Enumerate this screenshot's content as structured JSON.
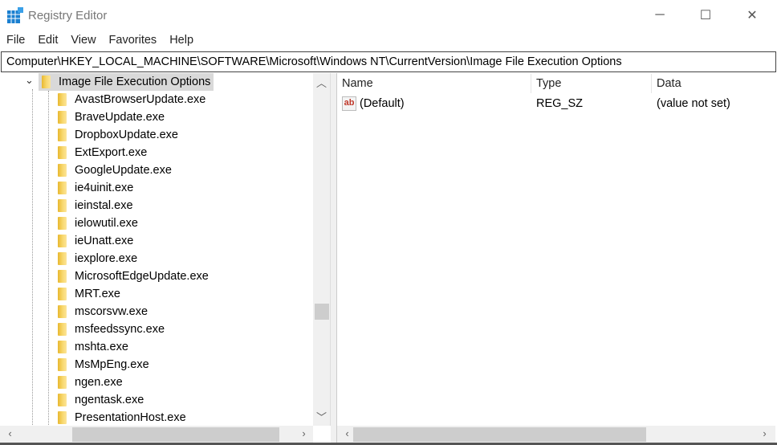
{
  "window": {
    "title": "Registry Editor",
    "minimize": "─",
    "maximize": "☐",
    "close": "✕"
  },
  "menu": [
    "File",
    "Edit",
    "View",
    "Favorites",
    "Help"
  ],
  "address": "Computer\\HKEY_LOCAL_MACHINE\\SOFTWARE\\Microsoft\\Windows NT\\CurrentVersion\\Image File Execution Options",
  "tree": {
    "selected": "Image File Execution Options",
    "children": [
      "AvastBrowserUpdate.exe",
      "BraveUpdate.exe",
      "DropboxUpdate.exe",
      "ExtExport.exe",
      "GoogleUpdate.exe",
      "ie4uinit.exe",
      "ieinstal.exe",
      "ielowutil.exe",
      "ieUnatt.exe",
      "iexplore.exe",
      "MicrosoftEdgeUpdate.exe",
      "MRT.exe",
      "mscorsvw.exe",
      "msfeedssync.exe",
      "mshta.exe",
      "MsMpEng.exe",
      "ngen.exe",
      "ngentask.exe",
      "PresentationHost.exe"
    ]
  },
  "values": {
    "columns": [
      "Name",
      "Type",
      "Data"
    ],
    "rows": [
      {
        "name": "(Default)",
        "type": "REG_SZ",
        "data": "(value not set)",
        "icon": "string-value-icon"
      }
    ]
  }
}
